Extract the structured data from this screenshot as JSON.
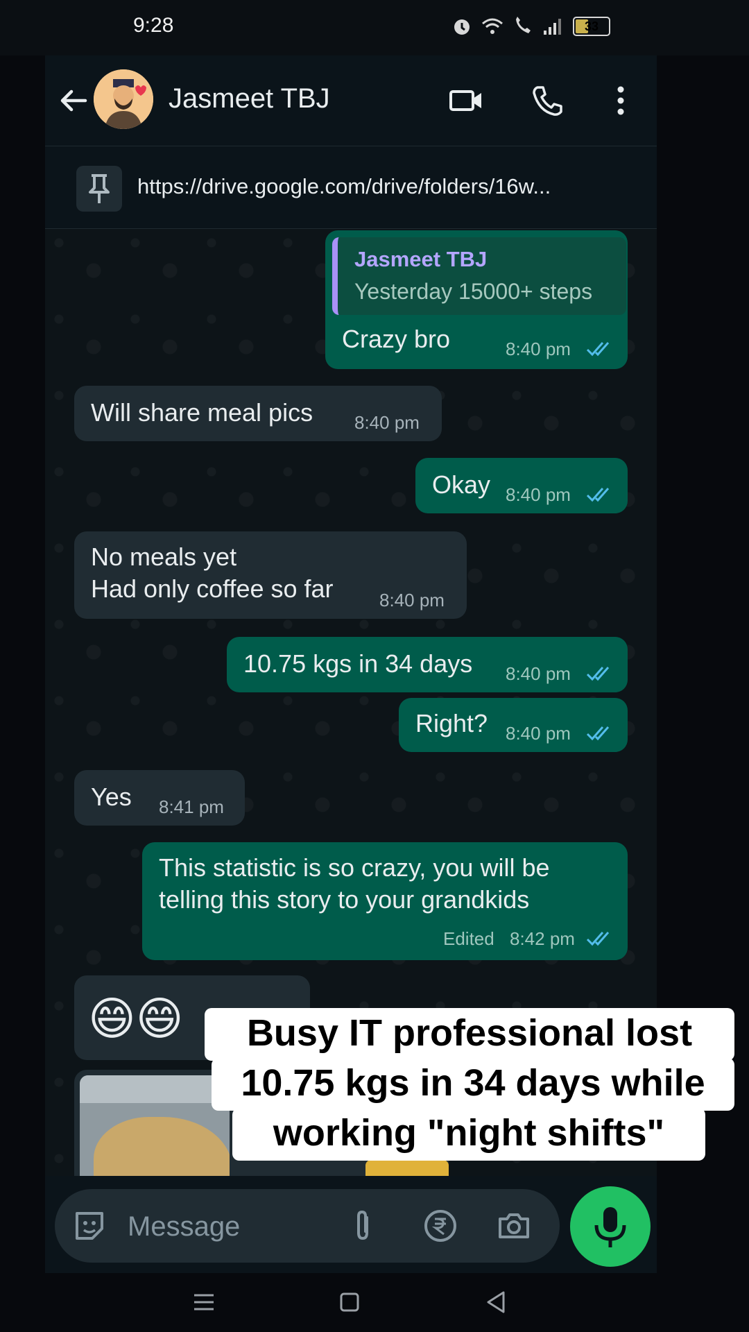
{
  "status_bar": {
    "time": "9:28",
    "battery": "33"
  },
  "header": {
    "contact_name": "Jasmeet TBJ"
  },
  "pinned": {
    "text": "https://drive.google.com/drive/folders/16w..."
  },
  "messages": [
    {
      "dir": "out",
      "quote_name": "Jasmeet TBJ",
      "quote_text": "Yesterday 15000+ steps",
      "text": "Crazy bro",
      "time": "8:40 pm"
    },
    {
      "dir": "in",
      "text": "Will share meal pics",
      "time": "8:40 pm"
    },
    {
      "dir": "out",
      "text": "Okay",
      "time": "8:40 pm"
    },
    {
      "dir": "in",
      "line1": "No meals yet",
      "line2": "Had only coffee so far",
      "time": "8:40 pm"
    },
    {
      "dir": "out",
      "text": "10.75 kgs in 34 days",
      "time": "8:40 pm"
    },
    {
      "dir": "out",
      "text": "Right?",
      "time": "8:40 pm"
    },
    {
      "dir": "in",
      "text": "Yes",
      "time": "8:41 pm"
    },
    {
      "dir": "out",
      "line1": "This statistic is so crazy, you will be",
      "line2": "telling this story to your grandkids",
      "edited": "Edited",
      "time": "8:42 pm"
    },
    {
      "dir": "in",
      "text": "😄😄"
    }
  ],
  "overlay": {
    "line1": "Busy IT professional lost",
    "line2": "10.75 kgs in 34 days while",
    "line3": "working \"night shifts\""
  },
  "input": {
    "placeholder": "Message"
  },
  "colors": {
    "outgoing": "#005c4b",
    "incoming": "#202c33",
    "mic": "#21c063",
    "ticks": "#53bdeb"
  }
}
